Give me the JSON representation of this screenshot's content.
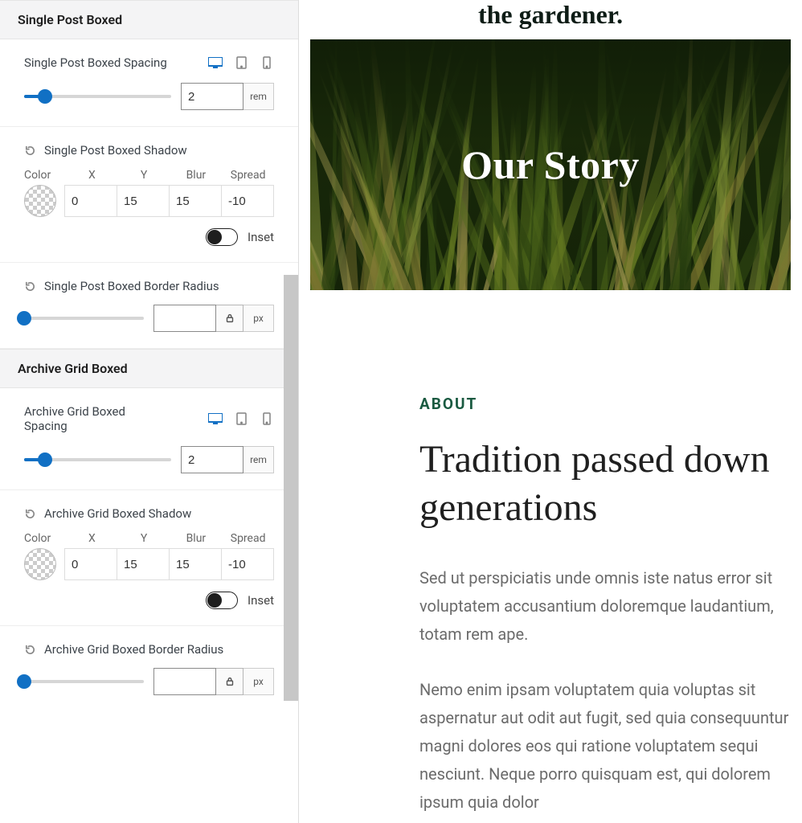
{
  "sections": {
    "singlePost": {
      "header": "Single Post Boxed",
      "spacing": {
        "label": "Single Post Boxed Spacing",
        "value": "2",
        "unit": "rem",
        "sliderPercent": 14
      },
      "shadow": {
        "label": "Single Post Boxed Shadow",
        "cols": {
          "color": "Color",
          "x": "X",
          "y": "Y",
          "blur": "Blur",
          "spread": "Spread"
        },
        "x": "0",
        "y": "15",
        "blur": "15",
        "spread": "-10",
        "insetLabel": "Inset",
        "inset": false
      },
      "radius": {
        "label": "Single Post Boxed Border Radius",
        "value": "",
        "unit": "px",
        "sliderPercent": 0
      }
    },
    "archive": {
      "header": "Archive Grid Boxed",
      "spacing": {
        "label": "Archive Grid Boxed Spacing",
        "value": "2",
        "unit": "rem",
        "sliderPercent": 14
      },
      "shadow": {
        "label": "Archive Grid Boxed Shadow",
        "cols": {
          "color": "Color",
          "x": "X",
          "y": "Y",
          "blur": "Blur",
          "spread": "Spread"
        },
        "x": "0",
        "y": "15",
        "blur": "15",
        "spread": "-10",
        "insetLabel": "Inset",
        "inset": false
      },
      "radius": {
        "label": "Archive Grid Boxed Border Radius",
        "value": "",
        "unit": "px",
        "sliderPercent": 0
      }
    }
  },
  "preview": {
    "topLine": "the gardener.",
    "heroTitle": "Our Story",
    "eyebrow": "ABOUT",
    "headline": "Tradition passed down generations",
    "para1": "Sed ut perspiciatis unde omnis iste natus error sit voluptatem accusantium doloremque laudantium, totam rem ape.",
    "para2": "Nemo enim ipsam voluptatem quia voluptas sit aspernatur aut odit aut fugit, sed quia consequuntur magni dolores eos qui ratione voluptatem sequi nesciunt. Neque porro quisquam est, qui dolorem ipsum quia dolor"
  }
}
